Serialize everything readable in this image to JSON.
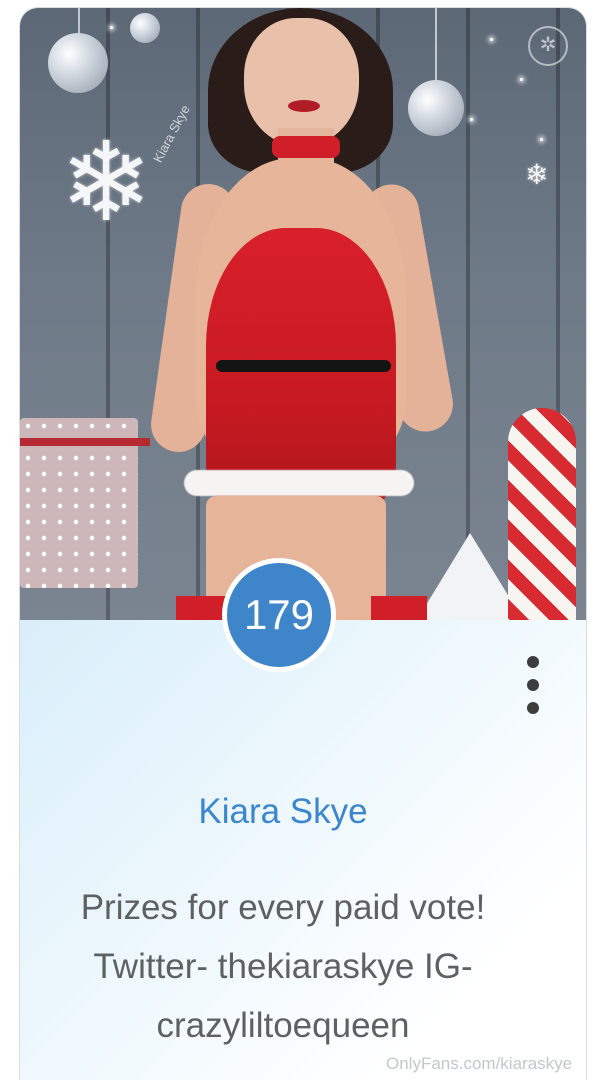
{
  "card": {
    "rank": "179",
    "name": "Kiara Skye",
    "description": "Prizes for every paid vote! Twitter- thekiaraskye IG- crazyliltoequeen",
    "photo_watermark": "Kiara Skye",
    "footer_watermark": "OnlyFans.com/kiaraskye",
    "menu_icon": "more-vertical-icon"
  },
  "colors": {
    "accent_blue": "#3f85c9",
    "name_blue": "#3b87cf",
    "body_text": "#5f6062"
  }
}
